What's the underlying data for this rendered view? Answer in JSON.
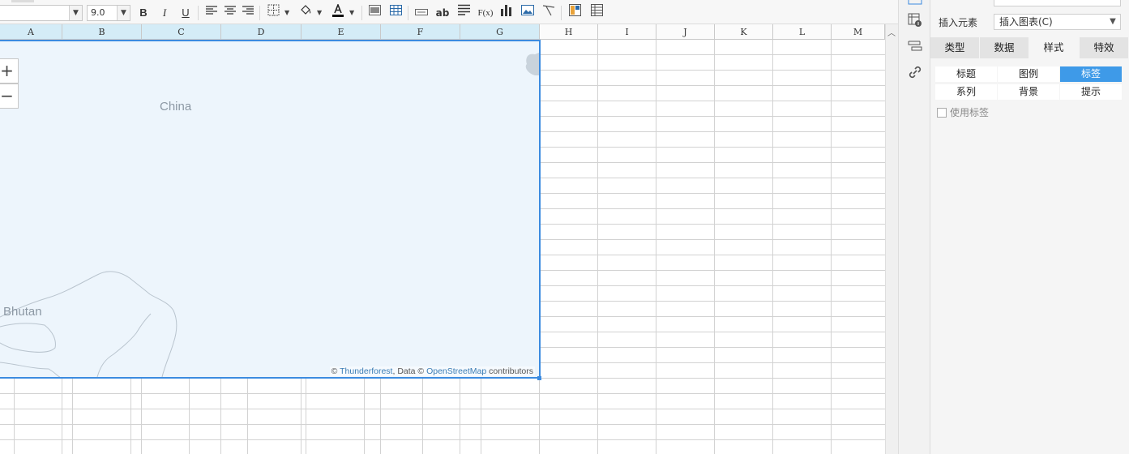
{
  "toolbar": {
    "font_size": "9.0",
    "bold": "B",
    "italic": "I",
    "underline": "U",
    "text_ab": "ab",
    "formula": "F(x)",
    "accent_color": "#3c8be0"
  },
  "sheet": {
    "columns": [
      "A",
      "B",
      "C",
      "D",
      "E",
      "F",
      "G",
      "H",
      "I",
      "J",
      "K",
      "L",
      "M"
    ]
  },
  "map": {
    "zoom_in": "+",
    "zoom_out": "−",
    "label_china": "China",
    "label_bhutan": "Bhutan",
    "attribution": {
      "prefix": "© ",
      "thunderforest": "Thunderforest",
      "data": ", Data © ",
      "osm": "OpenStreetMap",
      "suffix": " contributors"
    }
  },
  "panel": {
    "insert_label": "插入元素",
    "insert_value": "插入图表(C)",
    "main_tabs": [
      "类型",
      "数据",
      "样式",
      "特效"
    ],
    "active_main_tab": "样式",
    "sub_tabs": [
      "标题",
      "图例",
      "标签",
      "系列",
      "背景",
      "提示"
    ],
    "active_sub_tab": "标签",
    "use_label": "使用标签"
  }
}
